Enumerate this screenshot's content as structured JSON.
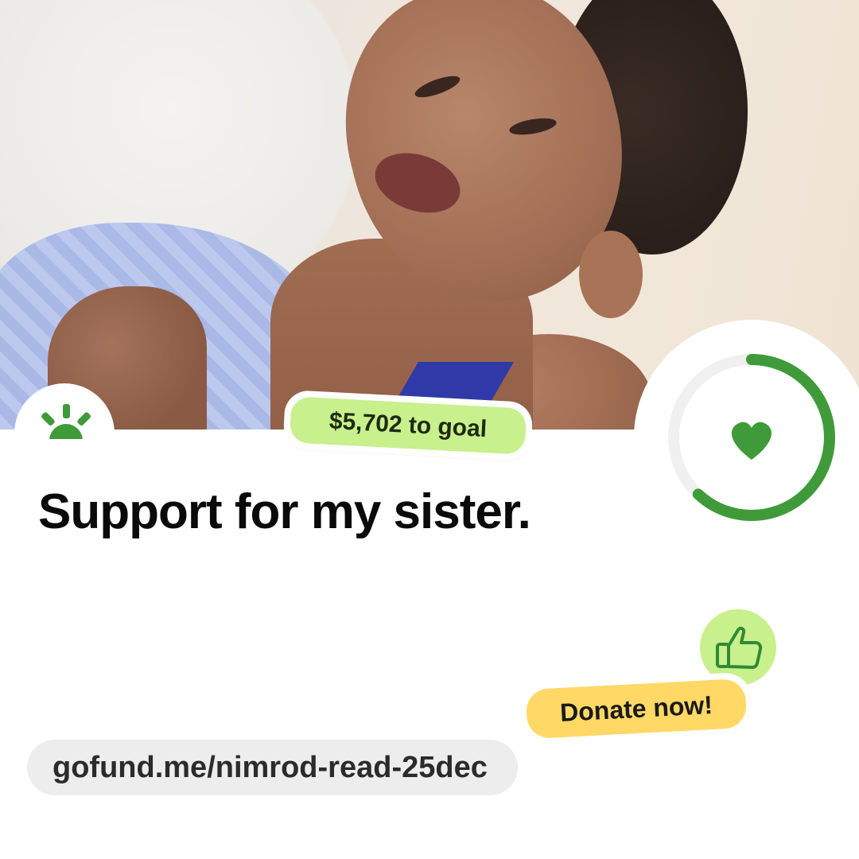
{
  "brand": {
    "logo_icon": "gofundme-sunrise-icon",
    "accent_green": "#3f9b3a",
    "light_green": "#c8f08c",
    "yellow": "#ffd866"
  },
  "fundraiser": {
    "title": "Support for my sister.",
    "to_goal_label": "$5,702 to goal",
    "progress_fraction": 0.62,
    "cta_label": "Donate now!",
    "url": "gofund.me/nimrod-read-25dec"
  },
  "icons": {
    "progress_center": "heart-icon",
    "cta_badge": "thumbs-up-icon"
  }
}
